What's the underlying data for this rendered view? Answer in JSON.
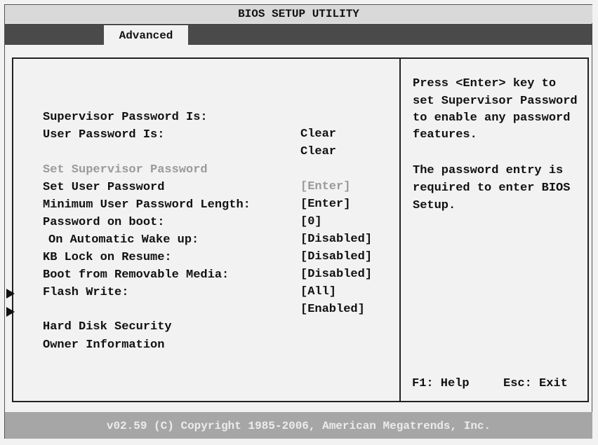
{
  "window": {
    "title": "BIOS SETUP UTILITY"
  },
  "tabs": [
    {
      "label": "Advanced",
      "active": true
    }
  ],
  "status": {
    "supervisor_password": {
      "label": "Supervisor Password Is:",
      "value": "Clear"
    },
    "user_password": {
      "label": "User Password Is:",
      "value": "Clear"
    }
  },
  "settings": [
    {
      "label": "Set Supervisor Password",
      "value": "[Enter]",
      "disabled": true
    },
    {
      "label": "Set User Password",
      "value": "[Enter]"
    },
    {
      "label": "Minimum User Password Length:",
      "value": "[0]"
    },
    {
      "label": "Password on boot:",
      "value": "[Disabled]"
    },
    {
      "label": "On Automatic Wake up:",
      "value": "[Disabled]"
    },
    {
      "label": "KB Lock on Resume:",
      "value": "[Disabled]"
    },
    {
      "label": "Boot from Removable Media:",
      "value": "[All]"
    },
    {
      "label": "Flash Write:",
      "value": "[Enabled]"
    }
  ],
  "submenus": [
    {
      "label": "Hard Disk Security",
      "icon": "triangle-right-icon"
    },
    {
      "label": "Owner Information",
      "icon": "triangle-right-icon"
    }
  ],
  "help": {
    "paragraph1": [
      "Press <Enter> key to",
      "set Supervisor Password",
      "to enable any password",
      "features."
    ],
    "paragraph2": [
      "The password entry is",
      "required to enter BIOS",
      "Setup."
    ],
    "keys": {
      "help": "F1: Help",
      "exit": "Esc: Exit"
    }
  },
  "footer": {
    "copyright": "v02.59 (C) Copyright 1985-2006, American Megatrends, Inc."
  },
  "colors": {
    "background": "#f2f2f2",
    "tab_strip": "#4a4a4a",
    "footer_bar": "#a6a6a6",
    "disabled_text": "#9a9a9a"
  }
}
